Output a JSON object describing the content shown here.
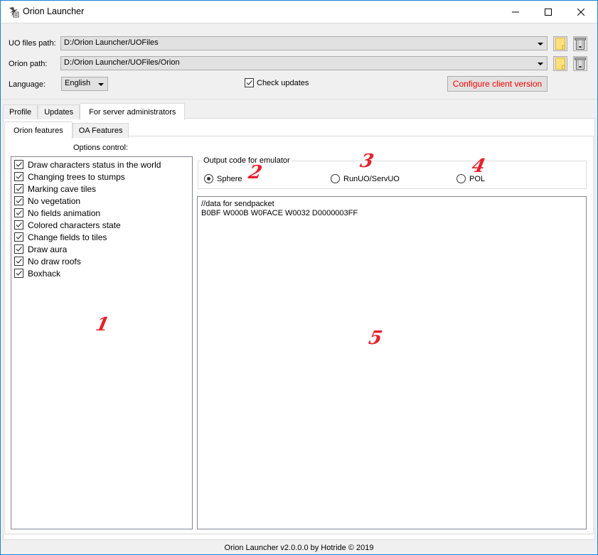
{
  "window": {
    "title": "Orion Launcher",
    "icons": {
      "app": "app-icon",
      "minimize": "minimize-icon",
      "maximize": "maximize-icon",
      "close": "close-icon"
    }
  },
  "paths": {
    "uo_files_label": "UO files path:",
    "uo_files_value": "D:/Orion Launcher/UOFiles",
    "orion_label": "Orion path:",
    "orion_value": "D:/Orion Launcher/UOFiles/Orion",
    "language_label": "Language:",
    "language_value": "English",
    "browse_icon": "folder-icon",
    "delete_icon": "trash-icon"
  },
  "check_updates": {
    "label": "Check updates",
    "checked": true
  },
  "configure_button": {
    "label": "Configure client version",
    "color": "#ff0000"
  },
  "main_tabs": [
    {
      "label": "Profile",
      "active": false
    },
    {
      "label": "Updates",
      "active": false
    },
    {
      "label": "For server administrators",
      "active": true
    }
  ],
  "sub_tabs": [
    {
      "label": "Orion features",
      "active": true
    },
    {
      "label": "OA Features",
      "active": false
    }
  ],
  "options": {
    "title": "Options control:",
    "items": [
      {
        "label": "Draw characters status in the world",
        "checked": true
      },
      {
        "label": "Changing trees to stumps",
        "checked": true
      },
      {
        "label": "Marking cave tiles",
        "checked": true
      },
      {
        "label": "No vegetation",
        "checked": true
      },
      {
        "label": "No fields animation",
        "checked": true
      },
      {
        "label": "Colored characters state",
        "checked": true
      },
      {
        "label": "Change fields to tiles",
        "checked": true
      },
      {
        "label": "Draw aura",
        "checked": true
      },
      {
        "label": "No draw roofs",
        "checked": true
      },
      {
        "label": "Boxhack",
        "checked": true
      }
    ]
  },
  "emulator": {
    "title": "Output code for emulator",
    "options": [
      {
        "label": "Sphere",
        "selected": true
      },
      {
        "label": "RunUO/ServUO",
        "selected": false
      },
      {
        "label": "POL",
        "selected": false
      }
    ]
  },
  "output_code": {
    "line1": "//data for sendpacket",
    "line2": "B0BF W000B W0FACE W0032 D0000003FF"
  },
  "annotations": [
    "1",
    "2",
    "3",
    "4",
    "5"
  ],
  "annotation_color": "#e8202a",
  "status": {
    "text": "Orion Launcher v2.0.0.0 by Hotride © 2019"
  }
}
